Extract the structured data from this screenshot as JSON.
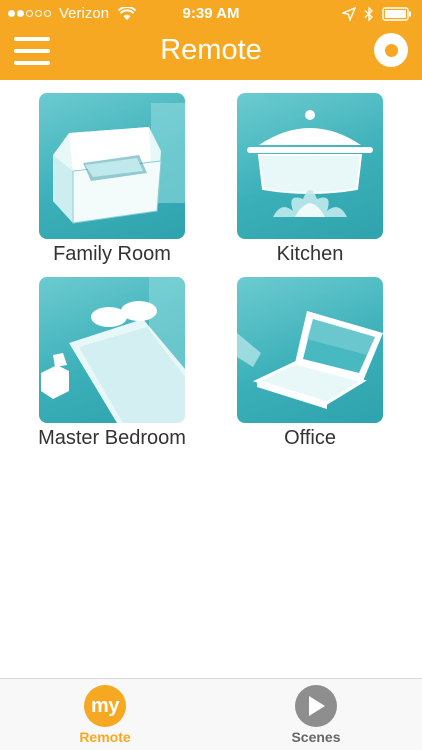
{
  "status_bar": {
    "carrier": "Verizon",
    "time": "9:39 AM",
    "signal_bars_filled": 2,
    "signal_bars_total": 5
  },
  "nav": {
    "title": "Remote",
    "menu_icon": "hamburger-icon",
    "power_icon": "power-icon"
  },
  "rooms": [
    {
      "label": "Family Room",
      "icon": "armchair-icon"
    },
    {
      "label": "Kitchen",
      "icon": "cooking-pot-icon"
    },
    {
      "label": "Master Bedroom",
      "icon": "bed-icon"
    },
    {
      "label": "Office",
      "icon": "laptop-icon"
    }
  ],
  "tab_bar": {
    "remote": {
      "label": "Remote",
      "icon_text": "my",
      "active": true
    },
    "scenes": {
      "label": "Scenes",
      "icon": "play-icon",
      "active": false
    }
  },
  "colors": {
    "accent": "#f7a823",
    "tile": "#3cb0b9",
    "inactive_tab": "#8e8e8e"
  }
}
